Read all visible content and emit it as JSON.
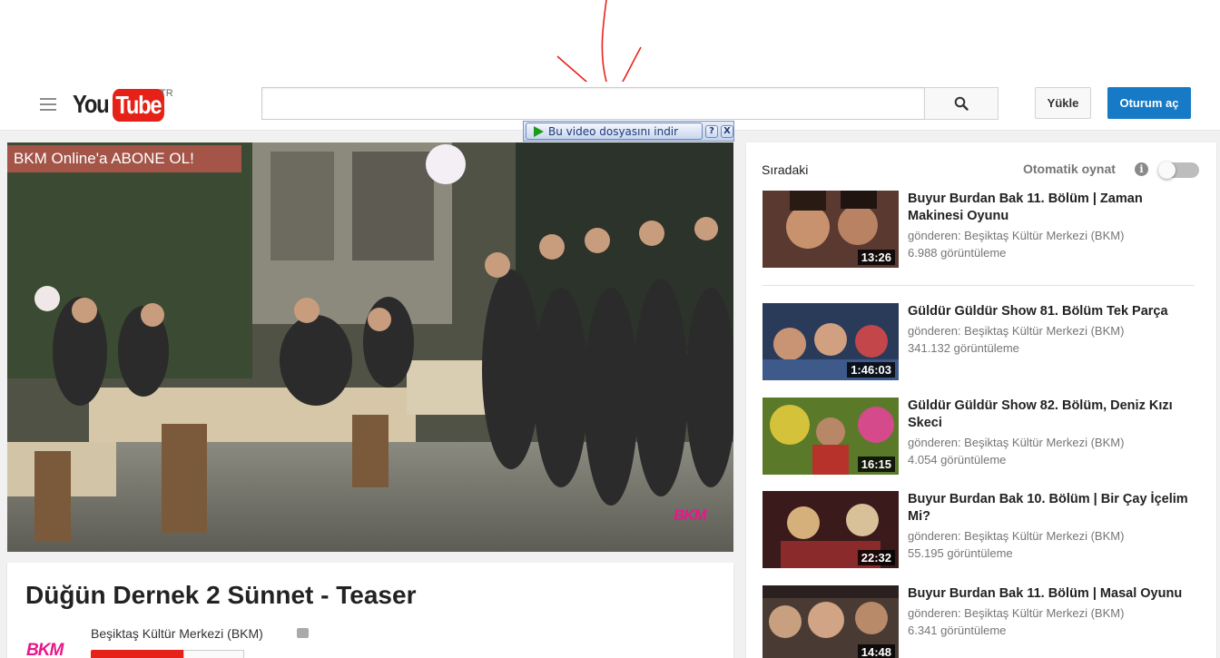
{
  "header": {
    "logo_you": "You",
    "logo_tube": "Tube",
    "country": "TR",
    "search_placeholder": "",
    "upload_label": "Yükle",
    "signin_label": "Oturum aç"
  },
  "download_toolbar": {
    "label": "Bu video dosyasını indir",
    "help": "?",
    "close": "X"
  },
  "player": {
    "banner": "BKM Online'a ABONE OL!",
    "watermark": "BKM"
  },
  "video": {
    "title": "Düğün Dernek 2 Sünnet - Teaser",
    "channel_logo": "BKM",
    "channel_name": "Beşiktaş Kültür Merkezi (BKM)"
  },
  "sidebar": {
    "up_next": "Sıradaki",
    "autoplay": "Otomatik oynat",
    "info": "i",
    "recommendations": [
      {
        "title": "Buyur Burdan Bak 11. Bölüm | Zaman Makinesi Oyunu",
        "channel": "gönderen: Beşiktaş Kültür Merkezi (BKM)",
        "views": "6.988 görüntüleme",
        "duration": "13:26"
      },
      {
        "title": "Güldür Güldür Show 81. Bölüm Tek Parça",
        "channel": "gönderen: Beşiktaş Kültür Merkezi (BKM)",
        "views": "341.132 görüntüleme",
        "duration": "1:46:03"
      },
      {
        "title": "Güldür Güldür Show 82. Bölüm, Deniz Kızı Skeci",
        "channel": "gönderen: Beşiktaş Kültür Merkezi (BKM)",
        "views": "4.054 görüntüleme",
        "duration": "16:15"
      },
      {
        "title": "Buyur Burdan Bak 10. Bölüm | Bir Çay İçelim Mi?",
        "channel": "gönderen: Beşiktaş Kültür Merkezi (BKM)",
        "views": "55.195 görüntüleme",
        "duration": "22:32"
      },
      {
        "title": "Buyur Burdan Bak 11. Bölüm | Masal Oyunu",
        "channel": "gönderen: Beşiktaş Kültür Merkezi (BKM)",
        "views": "6.341 görüntüleme",
        "duration": "14:48"
      }
    ]
  },
  "colors": {
    "brand_red": "#e62117",
    "signin_blue": "#167ac6",
    "bkm_pink": "#e8178a",
    "annotation_red": "#e8231c"
  },
  "icons": [
    "guide-menu-icon",
    "search-icon",
    "play-icon",
    "help-icon",
    "close-icon",
    "info-icon",
    "verified-icon"
  ]
}
